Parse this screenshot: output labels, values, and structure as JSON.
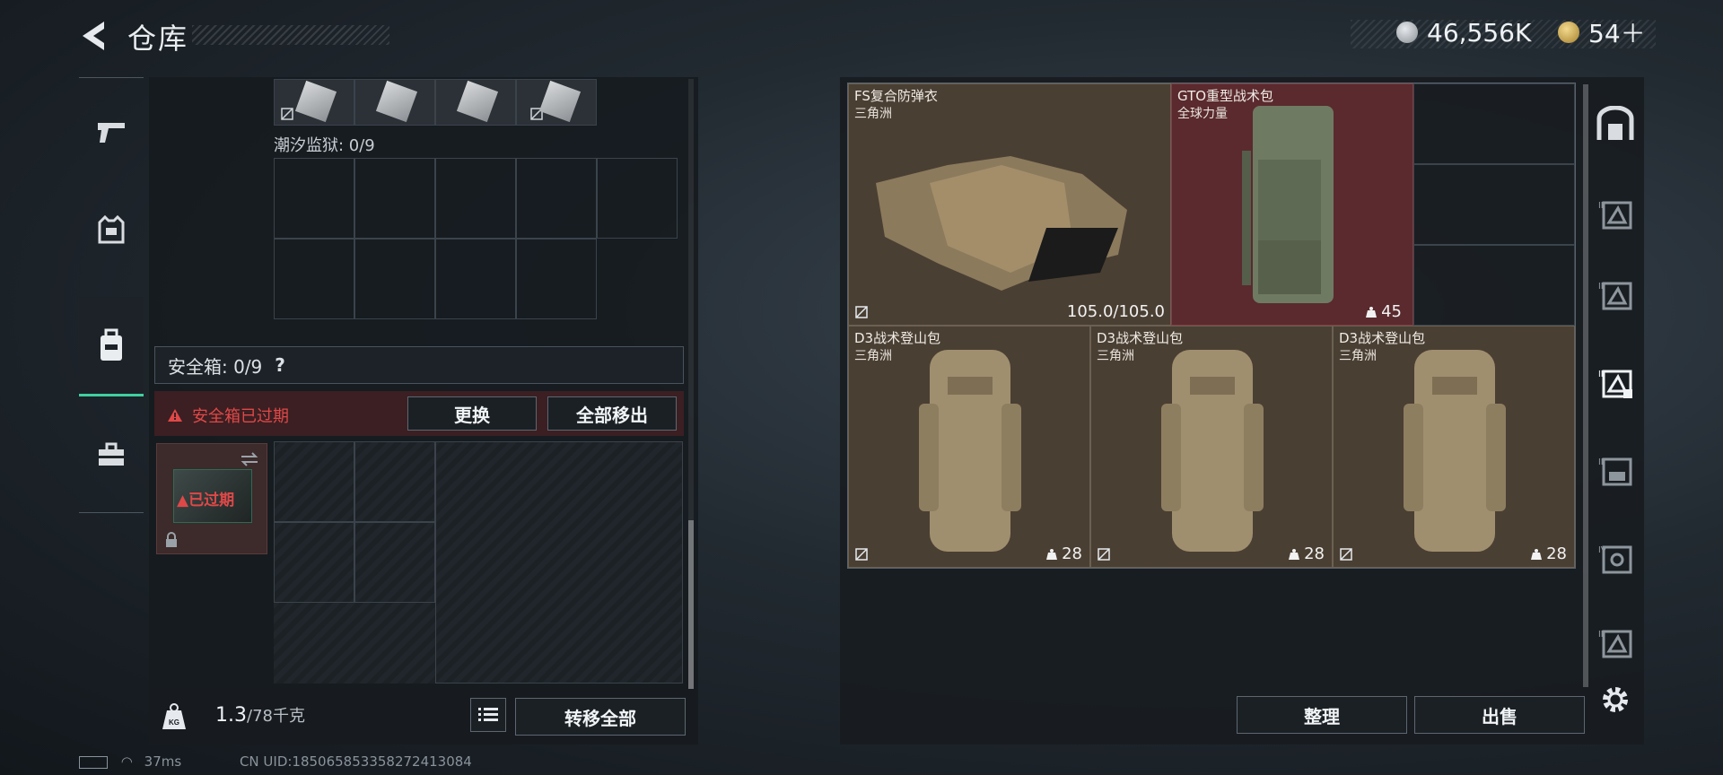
{
  "header": {
    "title": "仓库",
    "currency_1": "46,556K",
    "currency_2": "54＋"
  },
  "left_panel": {
    "tide_prison_label": "潮汐监狱: 0/9",
    "safe_box_label": "安全箱: 0/9",
    "help_glyph": "?",
    "warning_text": "安全箱已过期",
    "replace_button": "更换",
    "move_all_out_button": "全部移出",
    "case_item_text": "已过期",
    "weight_value": "1.3",
    "weight_capacity": "/78千克",
    "transfer_all_button": "转移全部"
  },
  "right_panel": {
    "items": [
      {
        "name": "FS复合防弹衣",
        "sub": "三角洲",
        "value": "105.0/105.0"
      },
      {
        "name": "GTO重型战术包",
        "sub": "全球力量",
        "value": "45"
      },
      {
        "name": "D3战术登山包",
        "sub": "三角洲",
        "value": "28"
      },
      {
        "name": "D3战术登山包",
        "sub": "三角洲",
        "value": "28"
      },
      {
        "name": "D3战术登山包",
        "sub": "三角洲",
        "value": "28"
      }
    ],
    "sort_button": "整理",
    "sell_button": "出售"
  },
  "status": {
    "ping": "37ms",
    "uid": "CN UID:185065853358272413084"
  },
  "colors": {
    "accent": "#3fd0a0",
    "warning": "#e04848",
    "item_brown": "#4a3f33",
    "item_red": "#5a2a2e"
  }
}
